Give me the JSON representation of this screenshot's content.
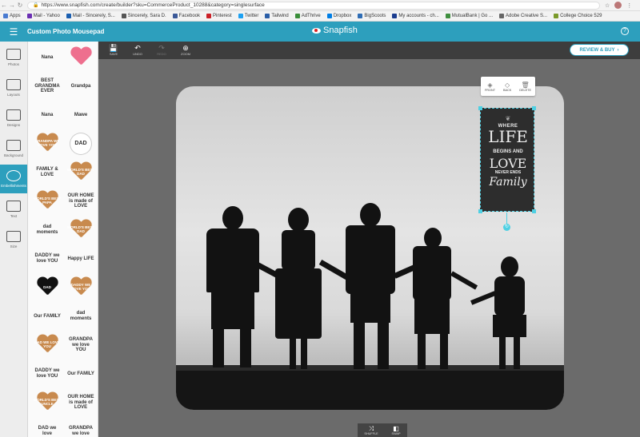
{
  "browser": {
    "url": "https://www.snapfish.com/create/builder?sku=CommerceProduct_10288&category=singlesurface",
    "nav": {
      "back": "←",
      "forward": "→",
      "reload": "↻"
    },
    "bookmarks": [
      {
        "label": "Apps",
        "color": "#4a7bd1"
      },
      {
        "label": "Mail - Yahoo",
        "color": "#6b2fb3"
      },
      {
        "label": "Mail - Sincerely, S...",
        "color": "#1b5fb0"
      },
      {
        "label": "Sincerely, Sara D.",
        "color": "#555555"
      },
      {
        "label": "Facebook",
        "color": "#3b5998"
      },
      {
        "label": "Pinterest",
        "color": "#cb2027"
      },
      {
        "label": "Twitter",
        "color": "#1da1f2"
      },
      {
        "label": "Tailwind",
        "color": "#2b5ea7"
      },
      {
        "label": "AdThrive",
        "color": "#3a8e3a"
      },
      {
        "label": "Dropbox",
        "color": "#007ee5"
      },
      {
        "label": "BigScoots",
        "color": "#2f6db5"
      },
      {
        "label": "My accounts - ch...",
        "color": "#1a3c8f"
      },
      {
        "label": "MutualBank | Go ...",
        "color": "#3f8f3f"
      },
      {
        "label": "Adobe Creative S...",
        "color": "#666666"
      },
      {
        "label": "College Choice 529",
        "color": "#7a9a2a"
      }
    ]
  },
  "app": {
    "menu_icon": "☰",
    "title": "Custom Photo Mousepad",
    "brand": "Snapfish",
    "help": "?"
  },
  "rail": [
    {
      "label": "Photos",
      "icon": "photos-icon",
      "active": false
    },
    {
      "label": "Layouts",
      "icon": "layouts-icon",
      "active": false
    },
    {
      "label": "Designs",
      "icon": "designs-icon",
      "active": false
    },
    {
      "label": "Background",
      "icon": "background-icon",
      "active": false
    },
    {
      "label": "Embellishments",
      "icon": "embellishments-icon",
      "active": true
    },
    {
      "label": "Text",
      "icon": "text-icon",
      "active": false
    },
    {
      "label": "Size",
      "icon": "size-icon",
      "active": false
    }
  ],
  "panel_tiles": [
    {
      "kind": "text",
      "text": "Nana",
      "col": 0,
      "row": 0
    },
    {
      "kind": "pink-heart",
      "text": "",
      "col": 1,
      "row": 0
    },
    {
      "kind": "text",
      "text": "BEST GRANDMA EVER",
      "col": 0,
      "row": 1
    },
    {
      "kind": "text",
      "text": "Grandpa",
      "col": 1,
      "row": 1
    },
    {
      "kind": "text",
      "text": "Nana",
      "col": 0,
      "row": 2
    },
    {
      "kind": "text",
      "text": "Mawe",
      "col": 1,
      "row": 2
    },
    {
      "kind": "wood-heart",
      "text": "GRANDPA WE LOVE YOU",
      "col": 0,
      "row": 3
    },
    {
      "kind": "circle",
      "text": "DAD",
      "col": 1,
      "row": 3
    },
    {
      "kind": "text",
      "text": "FAMILY & LOVE",
      "col": 0,
      "row": 4
    },
    {
      "kind": "wood-heart",
      "text": "WORLD'S BEST DAD",
      "col": 1,
      "row": 4
    },
    {
      "kind": "wood-heart",
      "text": "WORLD'S BEST PAPA",
      "col": 0,
      "row": 5
    },
    {
      "kind": "text",
      "text": "OUR HOME is made of LOVE",
      "col": 1,
      "row": 5
    },
    {
      "kind": "text",
      "text": "dad moments",
      "col": 0,
      "row": 6
    },
    {
      "kind": "wood-heart",
      "text": "WORLD'S BEST DAD",
      "col": 1,
      "row": 6
    },
    {
      "kind": "text",
      "text": "DADDY we love YOU",
      "col": 0,
      "row": 7
    },
    {
      "kind": "text",
      "text": "Happy LIFE",
      "col": 1,
      "row": 7
    },
    {
      "kind": "black-heart",
      "text": "DAD",
      "col": 0,
      "row": 8
    },
    {
      "kind": "wood-heart",
      "text": "DADDY WE LOVE YOU",
      "col": 1,
      "row": 8
    },
    {
      "kind": "text",
      "text": "Our FAMILY",
      "col": 0,
      "row": 9
    },
    {
      "kind": "text",
      "text": "dad moments",
      "col": 1,
      "row": 9
    },
    {
      "kind": "wood-heart",
      "text": "DAD WE LOVE YOU",
      "col": 0,
      "row": 10
    },
    {
      "kind": "text",
      "text": "GRANDPA we love YOU",
      "col": 1,
      "row": 10
    },
    {
      "kind": "text",
      "text": "DADDY we love YOU",
      "col": 0,
      "row": 11
    },
    {
      "kind": "text",
      "text": "Our FAMILY",
      "col": 1,
      "row": 11
    },
    {
      "kind": "wood-heart",
      "text": "WORLD'S BEST UNCLE",
      "col": 0,
      "row": 12
    },
    {
      "kind": "text",
      "text": "OUR HOME is made of LOVE",
      "col": 1,
      "row": 12
    },
    {
      "kind": "text",
      "text": "DAD we love",
      "col": 0,
      "row": 13
    },
    {
      "kind": "text",
      "text": "GRANDPA we love",
      "col": 1,
      "row": 13
    }
  ],
  "toolbar": {
    "save": "SAVE",
    "undo": "UNDO",
    "redo": "REDO",
    "zoom": "ZOOM",
    "review": "REVIEW & BUY"
  },
  "context_menu": {
    "front": "FRONT",
    "back": "BACK",
    "delete": "DELETE"
  },
  "selected_text": {
    "l1": "WHERE",
    "l2": "LIFE",
    "l3": "BEGINS AND",
    "l4": "LOVE",
    "l5": "NEVER ENDS",
    "l6": "Family"
  },
  "bottom_tray": {
    "shuffle": "SHUFFLE",
    "layout": "SWAP"
  },
  "colors": {
    "accent": "#2d9fbd",
    "selection": "#4ed0e3",
    "workspace": "#6b6b6b"
  }
}
